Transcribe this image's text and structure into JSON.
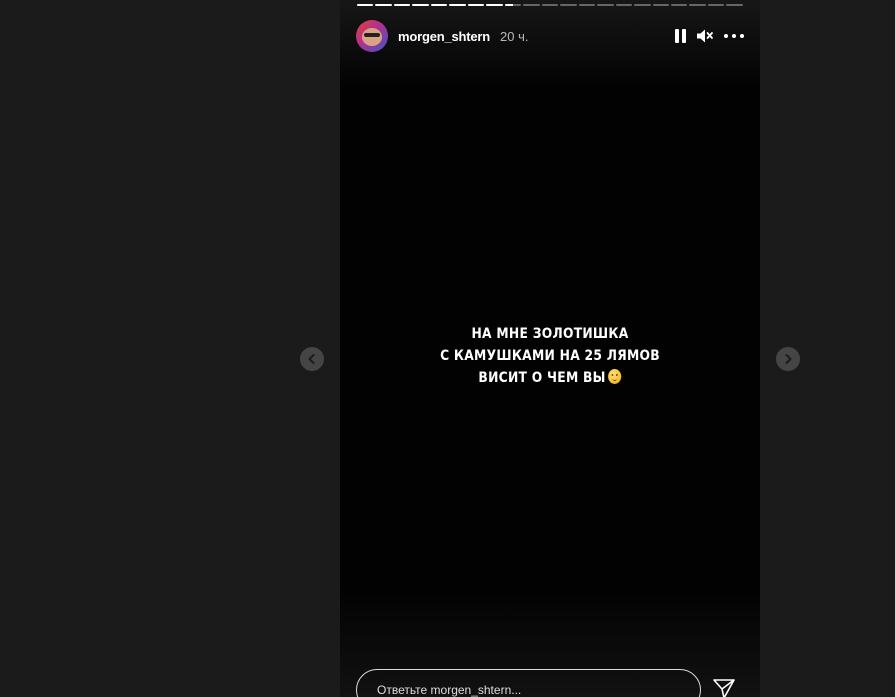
{
  "story": {
    "progress": {
      "segments": [
        1,
        1,
        1,
        1,
        1,
        1,
        1,
        1,
        0.5,
        0,
        0,
        0,
        0,
        0,
        0,
        0,
        0,
        0,
        0,
        0,
        0
      ]
    },
    "header": {
      "username": "morgen_shtern",
      "time": "20 ч.",
      "icons": [
        "pause-icon",
        "volume-muted-icon",
        "more-options-icon"
      ]
    },
    "text_lines": [
      "НА МНЕ ЗОЛОТИШКА",
      "С КАМУШКАМИ НА 25 ЛЯМОВ",
      "ВИСИТ О ЧЕМ ВЫ"
    ],
    "emoji": "smirking-face-emoji",
    "reply": {
      "placeholder": "Ответьте morgen_shtern..."
    }
  },
  "navigation": {
    "prev_icon": "chevron-left-icon",
    "next_icon": "chevron-right-icon"
  },
  "colors": {
    "page_background": "#1b1b1b",
    "story_background": "#020202",
    "text": "#ffffff"
  }
}
